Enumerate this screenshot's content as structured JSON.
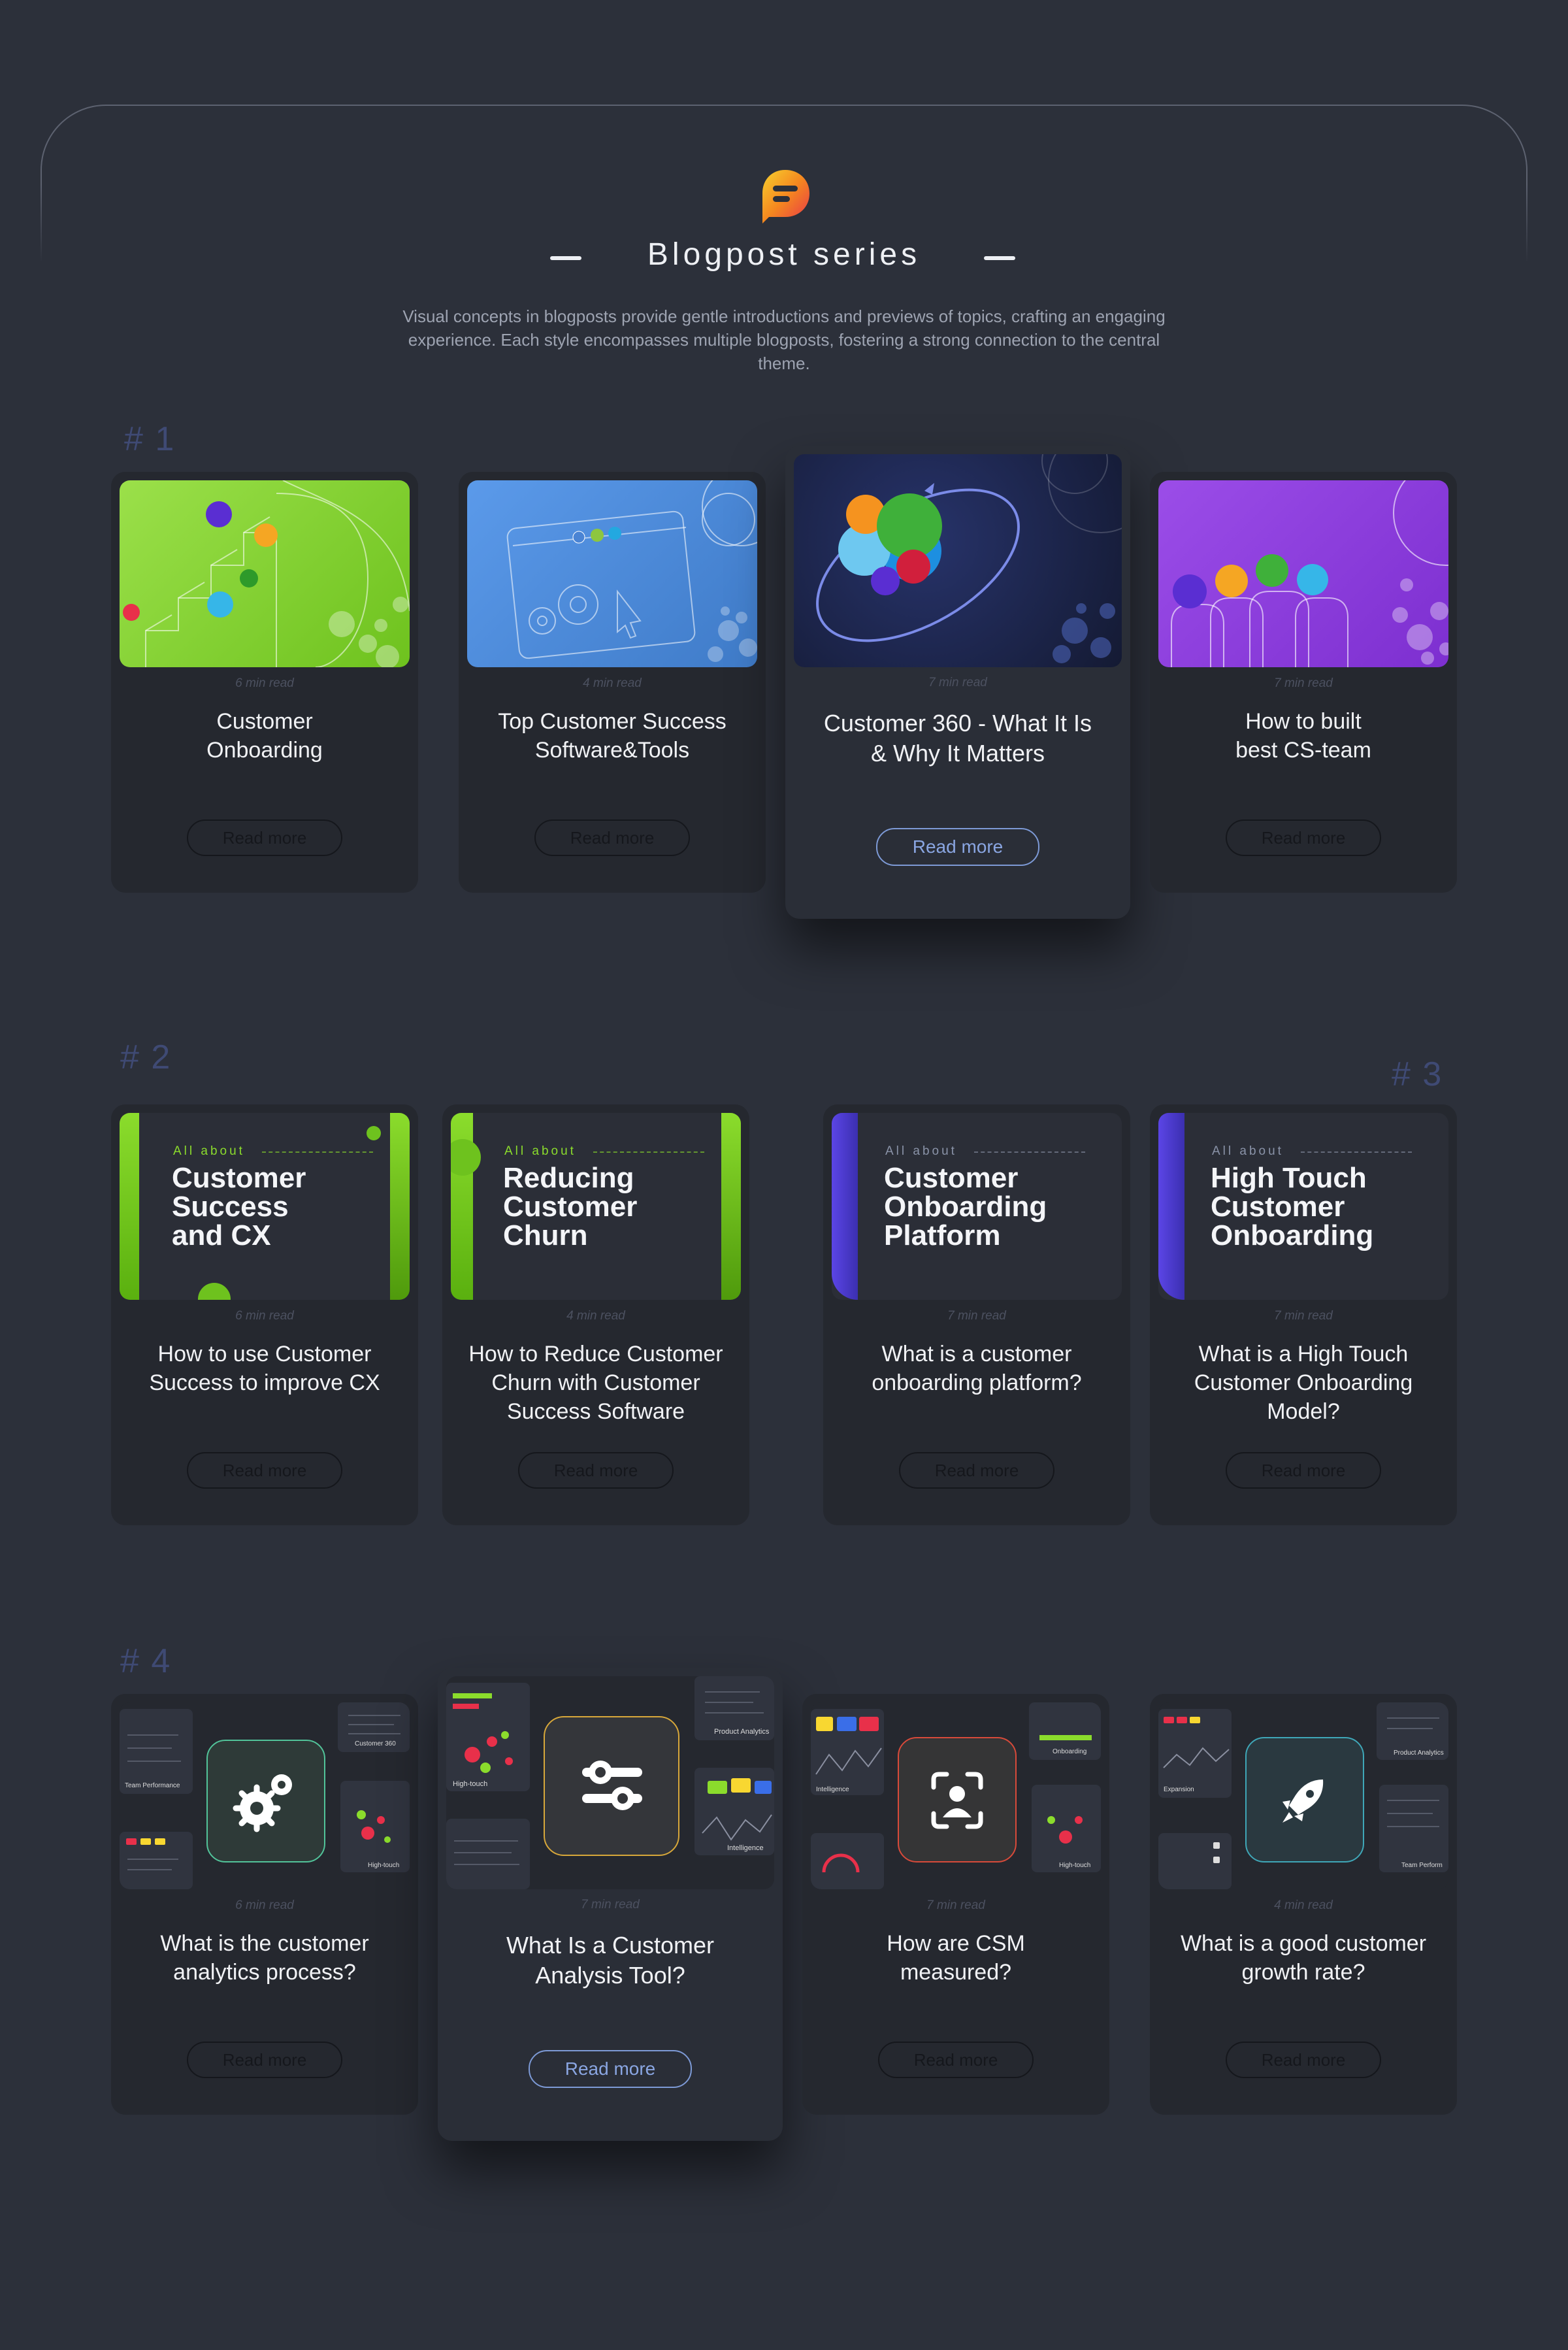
{
  "header": {
    "title": "Blogpost series",
    "intro": "Visual concepts in blogposts provide gentle introductions and previews of topics, crafting an engaging experience. Each style encompasses multiple blogposts, fostering a strong connection to the central theme."
  },
  "series": {
    "s1": "# 1",
    "s2": "# 2",
    "s3": "# 3",
    "s4": "# 4"
  },
  "colors": {
    "background": "#2c303a",
    "card": "#25282f",
    "accent_blue": "#7d9ad6",
    "green": "#7ed321",
    "purple": "#8a3be0",
    "blue": "#4a84d4"
  },
  "cards": [
    {
      "read_time": "6 min read",
      "title": "Customer Onboarding",
      "button": "Read more",
      "thumb_icon": "stairs-balls-illustration"
    },
    {
      "read_time": "4 min read",
      "title": "Top Customer Success Software&Tools",
      "button": "Read more",
      "thumb_icon": "browser-gears-illustration"
    },
    {
      "read_time": "7 min read",
      "title": "Customer 360 - What It Is & Why It Matters",
      "button": "Read more",
      "thumb_icon": "orbit-balls-illustration"
    },
    {
      "read_time": "7 min read",
      "title": "How to built best CS-team",
      "button": "Read more",
      "thumb_icon": "team-balls-illustration"
    },
    {
      "read_time": "6 min read",
      "title": "How to use Customer Success to improve CX",
      "button": "Read more",
      "thumb_label": "All about",
      "thumb_title": "Customer Success and CX"
    },
    {
      "read_time": "4 min read",
      "title": "How to Reduce Customer Churn with Customer Success Software",
      "button": "Read more",
      "thumb_label": "All about",
      "thumb_title": "Reducing Customer Churn"
    },
    {
      "read_time": "7 min read",
      "title": "What is a customer onboarding platform?",
      "button": "Read more",
      "thumb_label": "All about",
      "thumb_title": "Customer Onboarding Platform"
    },
    {
      "read_time": "7 min read",
      "title": "What is a High Touch Customer Onboarding Model?",
      "button": "Read more",
      "thumb_label": "All about",
      "thumb_title": "High Touch Customer Onboarding"
    },
    {
      "read_time": "6 min read",
      "title": "What is the customer analytics process?",
      "button": "Read more",
      "thumb_icon": "gears-icon",
      "panels": [
        "Team Performance",
        "Customer 360",
        "High-touch"
      ]
    },
    {
      "read_time": "7 min read",
      "title": "What Is a Customer Analysis Tool?",
      "button": "Read more",
      "thumb_icon": "sliders-icon",
      "panels": [
        "Product Analytics",
        "High-touch",
        "Intelligence"
      ]
    },
    {
      "read_time": "7 min read",
      "title": "How are CSM measured?",
      "button": "Read more",
      "thumb_icon": "user-focus-icon",
      "panels": [
        "Onboarding",
        "Intelligence",
        "High-touch"
      ]
    },
    {
      "read_time": "4 min read",
      "title": "What is a good customer growth rate?",
      "button": "Read more",
      "thumb_icon": "rocket-icon",
      "panels": [
        "Product Analytics",
        "Expansion",
        "Team Perform"
      ]
    }
  ]
}
